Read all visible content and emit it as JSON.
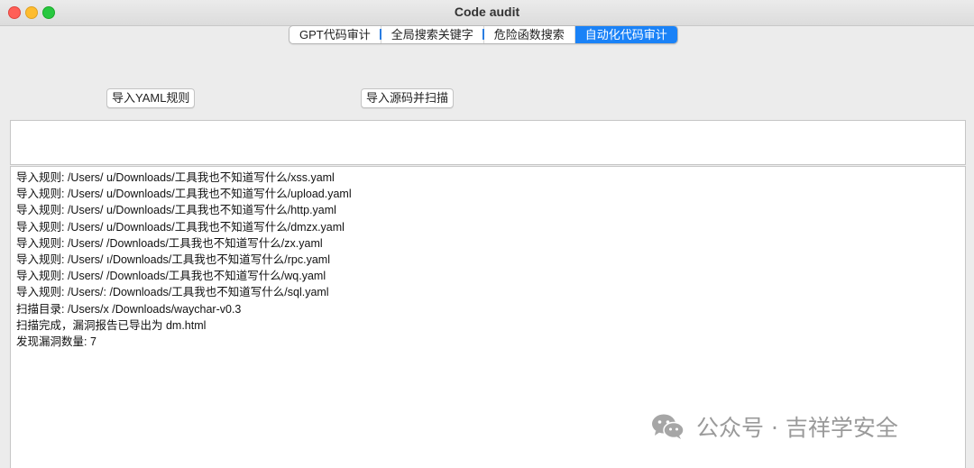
{
  "window": {
    "title": "Code audit"
  },
  "tabs": [
    {
      "label": "GPT代码审计",
      "active": false
    },
    {
      "label": "全局搜索关键字",
      "active": false
    },
    {
      "label": "危险函数搜索",
      "active": false
    },
    {
      "label": "自动化代码审计",
      "active": true
    }
  ],
  "buttons": {
    "import_yaml": "导入YAML规则",
    "import_scan": "导入源码并扫描"
  },
  "input": {
    "value": ""
  },
  "log": [
    "导入规则: /Users/        u/Downloads/工具我也不知道写什么/xss.yaml",
    "导入规则: /Users/        u/Downloads/工具我也不知道写什么/upload.yaml",
    "导入规则: /Users/        u/Downloads/工具我也不知道写什么/http.yaml",
    "导入规则: /Users/        u/Downloads/工具我也不知道写什么/dmzx.yaml",
    "导入规则: /Users/        /Downloads/工具我也不知道写什么/zx.yaml",
    "导入规则: /Users/        ı/Downloads/工具我也不知道写什么/rpc.yaml",
    "导入规则: /Users/        /Downloads/工具我也不知道写什么/wq.yaml",
    "导入规则: /Users/:       /Downloads/工具我也不知道写什么/sql.yaml",
    "扫描目录: /Users/x        /Downloads/waychar-v0.3",
    "扫描完成，漏洞报告已导出为 dm.html",
    "发现漏洞数量: 7"
  ],
  "watermark": {
    "text": "公众号 · 吉祥学安全"
  },
  "colors": {
    "accent": "#1a82f7",
    "close": "#ff5f57",
    "minimize": "#febc2e",
    "zoom": "#28c840"
  }
}
